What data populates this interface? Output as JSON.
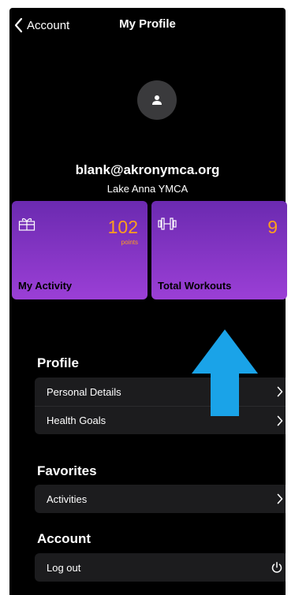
{
  "header": {
    "back_label": "Account",
    "title": "My Profile"
  },
  "profile": {
    "avatar_icon": "person-icon",
    "email": "blank@akronymca.org",
    "location": "Lake Anna YMCA"
  },
  "stats": {
    "activity": {
      "icon": "gift-icon",
      "value": "102",
      "unit": "points",
      "label": "My Activity"
    },
    "workouts": {
      "icon": "dumbbell-icon",
      "value": "9",
      "label": "Total Workouts"
    }
  },
  "sections": {
    "profile": {
      "title": "Profile",
      "items": [
        {
          "label": "Personal Details"
        },
        {
          "label": "Health Goals"
        }
      ]
    },
    "favorites": {
      "title": "Favorites",
      "items": [
        {
          "label": "Activities"
        }
      ]
    },
    "account": {
      "title": "Account",
      "items": [
        {
          "label": "Log out"
        }
      ]
    }
  },
  "colors": {
    "background": "#000000",
    "card_gradient_top": "#6b2ab0",
    "card_gradient_bottom": "#9b3fd6",
    "accent_orange": "#ff9f1c",
    "row_background": "#1c1c1e",
    "annotation_arrow": "#1aa3e8"
  }
}
